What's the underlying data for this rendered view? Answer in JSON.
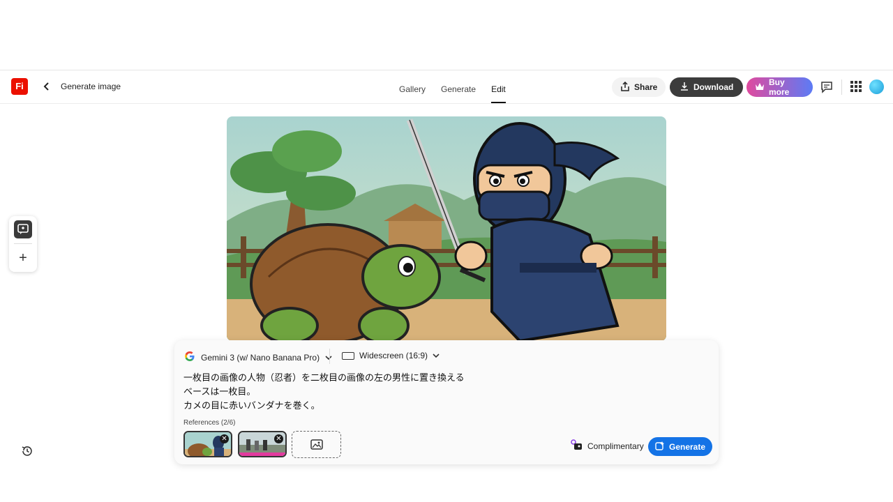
{
  "app": {
    "logo_text": "Fi",
    "page_title": "Generate image"
  },
  "tabs": [
    {
      "label": "Gallery"
    },
    {
      "label": "Generate"
    },
    {
      "label": "Edit",
      "active": true
    }
  ],
  "actions": {
    "share": "Share",
    "download": "Download",
    "buy_more": "Buy more"
  },
  "colors": {
    "brand": "#eb1000",
    "primary": "#1473e6",
    "download_bg": "#3c3c3c"
  },
  "panel": {
    "model": "Gemini 3 (w/ Nano Banana Pro)",
    "aspect_ratio": "Widescreen (16:9)",
    "prompt": "一枚目の画像の人物（忍者）を二枚目の画像の左の男性に置き換える\nベースは一枚目。\nカメの目に赤いバンダナを巻く。",
    "references_label": "References (2/6)",
    "complimentary": "Complimentary",
    "generate": "Generate"
  },
  "icons": [
    "back-icon",
    "share-icon",
    "download-icon",
    "crown-icon",
    "comment-icon",
    "apps-grid-icon",
    "chat-edit-icon",
    "plus-icon",
    "history-icon",
    "google-icon",
    "chevron-down-icon",
    "aspect-ratio-icon",
    "close-icon",
    "image-add-icon",
    "credits-icon",
    "generate-icon"
  ]
}
